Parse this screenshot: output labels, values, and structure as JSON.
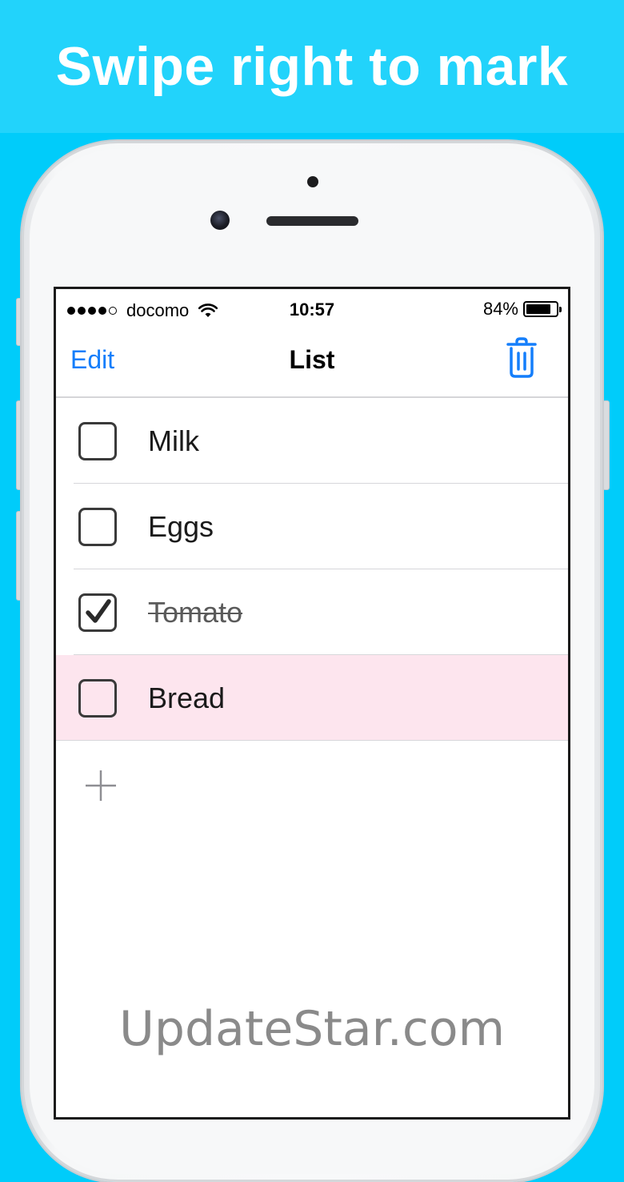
{
  "banner": {
    "title": "Swipe right to mark"
  },
  "status_bar": {
    "carrier": "docomo",
    "time": "10:57",
    "battery_percent": "84%",
    "battery_level": 0.84,
    "signal_bars_filled": 4,
    "signal_bars_total": 5
  },
  "nav": {
    "edit_label": "Edit",
    "title": "List",
    "right_icon": "trash-icon"
  },
  "items": [
    {
      "label": "Milk",
      "checked": false
    },
    {
      "label": "Eggs",
      "checked": false
    },
    {
      "label": "Tomato",
      "checked": true
    },
    {
      "label": "Bread",
      "checked": false,
      "highlighted": true
    }
  ],
  "add_icon": "plus-icon",
  "watermark": "UpdateStar.com",
  "colors": {
    "background": "#00ccfa",
    "banner": "#22d3fb",
    "ios_blue": "#147efb",
    "highlight_row": "#fde5ee"
  }
}
